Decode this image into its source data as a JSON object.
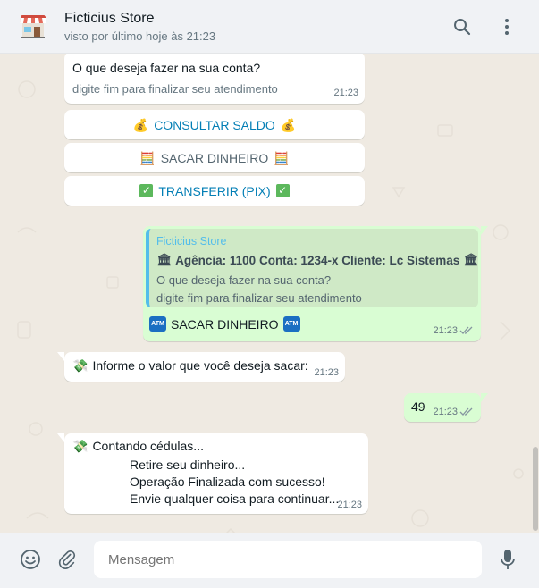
{
  "header": {
    "title": "Ficticius Store",
    "subtitle": "visto por último hoje às 21:23"
  },
  "messages": {
    "m1": {
      "line1": "O que deseja fazer na sua conta?",
      "line2": "digite fim para finalizar seu atendimento",
      "time": "21:23"
    },
    "buttons": [
      {
        "label": "CONSULTAR SALDO",
        "icon": "money-bag-emoji"
      },
      {
        "label": "SACAR DINHEIRO",
        "icon": "calculator-emoji"
      },
      {
        "label": "TRANSFERIR (PIX)",
        "icon": "check-mark-emoji"
      }
    ],
    "m2": {
      "quote_author": "Ficticius Store",
      "quote_title": "Agência: 1100 Conta: 1234-x Cliente: Lc Sistemas",
      "quote_line1": "O que deseja fazer na sua conta?",
      "quote_line2": "digite fim para finalizar seu atendimento",
      "text": "SACAR DINHEIRO",
      "time": "21:23"
    },
    "m3": {
      "text": "Informe o valor que você deseja sacar:",
      "time": "21:23"
    },
    "m4": {
      "text": "49",
      "time": "21:23"
    },
    "m5": {
      "line1": "Contando cédulas...",
      "line2": "Retire seu dinheiro...",
      "line3": "Operação Finalizada com sucesso!",
      "line4": "Envie qualquer coisa para continuar...",
      "time": "21:23"
    }
  },
  "footer": {
    "placeholder": "Mensagem"
  },
  "colors": {
    "accent_link": "#027eb5",
    "quote_bar": "#53bdeb",
    "outgoing": "#d9fdd3",
    "read_ticks": "#8696a0"
  }
}
